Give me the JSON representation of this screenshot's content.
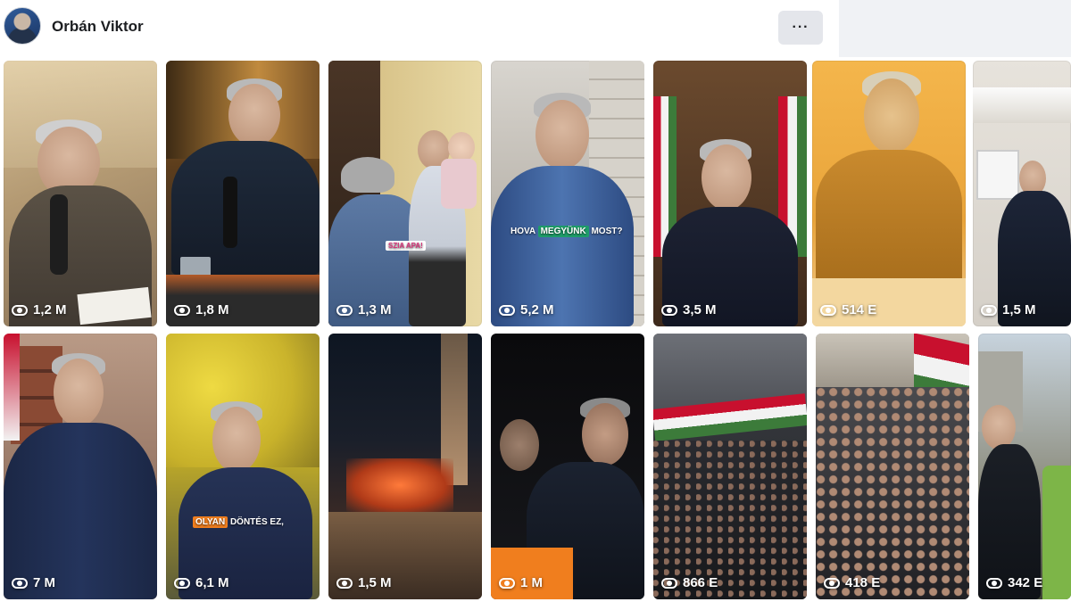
{
  "page": {
    "name": "Orbán Viktor",
    "more_label": "···"
  },
  "reels": [
    {
      "views": "1,2 M"
    },
    {
      "views": "1,8 M"
    },
    {
      "views": "1,3 M",
      "caption_parts": [
        "SZIA APA!"
      ]
    },
    {
      "views": "5,2 M",
      "caption_parts": [
        "HOVA",
        "MEGYÜNK",
        "MOST?"
      ]
    },
    {
      "views": "3,5 M"
    },
    {
      "views": "514 E"
    },
    {
      "views": "1,5 M"
    },
    {
      "views": "7 M"
    },
    {
      "views": "6,1 M",
      "caption_parts": [
        "OLYAN",
        "DÖNTÉS EZ,"
      ]
    },
    {
      "views": "1,5 M"
    },
    {
      "views": "1 M"
    },
    {
      "views": "866 E"
    },
    {
      "views": "418 E"
    },
    {
      "views": "342 E"
    }
  ],
  "colors": {
    "accent_green": "#1f9e6a",
    "accent_orange": "#f07e1e",
    "accent_pink": "#d8347a",
    "hungary_red": "#c8102e",
    "hungary_green": "#3c7b3a"
  }
}
